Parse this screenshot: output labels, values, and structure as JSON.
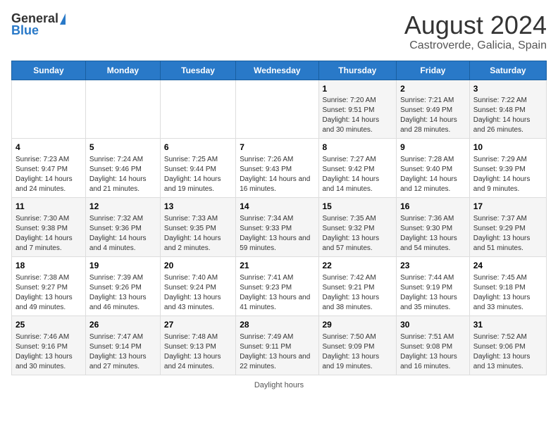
{
  "header": {
    "logo_general": "General",
    "logo_blue": "Blue",
    "main_title": "August 2024",
    "subtitle": "Castroverde, Galicia, Spain"
  },
  "calendar": {
    "days_of_week": [
      "Sunday",
      "Monday",
      "Tuesday",
      "Wednesday",
      "Thursday",
      "Friday",
      "Saturday"
    ],
    "weeks": [
      [
        {
          "day": "",
          "info": ""
        },
        {
          "day": "",
          "info": ""
        },
        {
          "day": "",
          "info": ""
        },
        {
          "day": "",
          "info": ""
        },
        {
          "day": "1",
          "info": "Sunrise: 7:20 AM\nSunset: 9:51 PM\nDaylight: 14 hours and 30 minutes."
        },
        {
          "day": "2",
          "info": "Sunrise: 7:21 AM\nSunset: 9:49 PM\nDaylight: 14 hours and 28 minutes."
        },
        {
          "day": "3",
          "info": "Sunrise: 7:22 AM\nSunset: 9:48 PM\nDaylight: 14 hours and 26 minutes."
        }
      ],
      [
        {
          "day": "4",
          "info": "Sunrise: 7:23 AM\nSunset: 9:47 PM\nDaylight: 14 hours and 24 minutes."
        },
        {
          "day": "5",
          "info": "Sunrise: 7:24 AM\nSunset: 9:46 PM\nDaylight: 14 hours and 21 minutes."
        },
        {
          "day": "6",
          "info": "Sunrise: 7:25 AM\nSunset: 9:44 PM\nDaylight: 14 hours and 19 minutes."
        },
        {
          "day": "7",
          "info": "Sunrise: 7:26 AM\nSunset: 9:43 PM\nDaylight: 14 hours and 16 minutes."
        },
        {
          "day": "8",
          "info": "Sunrise: 7:27 AM\nSunset: 9:42 PM\nDaylight: 14 hours and 14 minutes."
        },
        {
          "day": "9",
          "info": "Sunrise: 7:28 AM\nSunset: 9:40 PM\nDaylight: 14 hours and 12 minutes."
        },
        {
          "day": "10",
          "info": "Sunrise: 7:29 AM\nSunset: 9:39 PM\nDaylight: 14 hours and 9 minutes."
        }
      ],
      [
        {
          "day": "11",
          "info": "Sunrise: 7:30 AM\nSunset: 9:38 PM\nDaylight: 14 hours and 7 minutes."
        },
        {
          "day": "12",
          "info": "Sunrise: 7:32 AM\nSunset: 9:36 PM\nDaylight: 14 hours and 4 minutes."
        },
        {
          "day": "13",
          "info": "Sunrise: 7:33 AM\nSunset: 9:35 PM\nDaylight: 14 hours and 2 minutes."
        },
        {
          "day": "14",
          "info": "Sunrise: 7:34 AM\nSunset: 9:33 PM\nDaylight: 13 hours and 59 minutes."
        },
        {
          "day": "15",
          "info": "Sunrise: 7:35 AM\nSunset: 9:32 PM\nDaylight: 13 hours and 57 minutes."
        },
        {
          "day": "16",
          "info": "Sunrise: 7:36 AM\nSunset: 9:30 PM\nDaylight: 13 hours and 54 minutes."
        },
        {
          "day": "17",
          "info": "Sunrise: 7:37 AM\nSunset: 9:29 PM\nDaylight: 13 hours and 51 minutes."
        }
      ],
      [
        {
          "day": "18",
          "info": "Sunrise: 7:38 AM\nSunset: 9:27 PM\nDaylight: 13 hours and 49 minutes."
        },
        {
          "day": "19",
          "info": "Sunrise: 7:39 AM\nSunset: 9:26 PM\nDaylight: 13 hours and 46 minutes."
        },
        {
          "day": "20",
          "info": "Sunrise: 7:40 AM\nSunset: 9:24 PM\nDaylight: 13 hours and 43 minutes."
        },
        {
          "day": "21",
          "info": "Sunrise: 7:41 AM\nSunset: 9:23 PM\nDaylight: 13 hours and 41 minutes."
        },
        {
          "day": "22",
          "info": "Sunrise: 7:42 AM\nSunset: 9:21 PM\nDaylight: 13 hours and 38 minutes."
        },
        {
          "day": "23",
          "info": "Sunrise: 7:44 AM\nSunset: 9:19 PM\nDaylight: 13 hours and 35 minutes."
        },
        {
          "day": "24",
          "info": "Sunrise: 7:45 AM\nSunset: 9:18 PM\nDaylight: 13 hours and 33 minutes."
        }
      ],
      [
        {
          "day": "25",
          "info": "Sunrise: 7:46 AM\nSunset: 9:16 PM\nDaylight: 13 hours and 30 minutes."
        },
        {
          "day": "26",
          "info": "Sunrise: 7:47 AM\nSunset: 9:14 PM\nDaylight: 13 hours and 27 minutes."
        },
        {
          "day": "27",
          "info": "Sunrise: 7:48 AM\nSunset: 9:13 PM\nDaylight: 13 hours and 24 minutes."
        },
        {
          "day": "28",
          "info": "Sunrise: 7:49 AM\nSunset: 9:11 PM\nDaylight: 13 hours and 22 minutes."
        },
        {
          "day": "29",
          "info": "Sunrise: 7:50 AM\nSunset: 9:09 PM\nDaylight: 13 hours and 19 minutes."
        },
        {
          "day": "30",
          "info": "Sunrise: 7:51 AM\nSunset: 9:08 PM\nDaylight: 13 hours and 16 minutes."
        },
        {
          "day": "31",
          "info": "Sunrise: 7:52 AM\nSunset: 9:06 PM\nDaylight: 13 hours and 13 minutes."
        }
      ]
    ]
  },
  "footer": {
    "note": "Daylight hours"
  }
}
